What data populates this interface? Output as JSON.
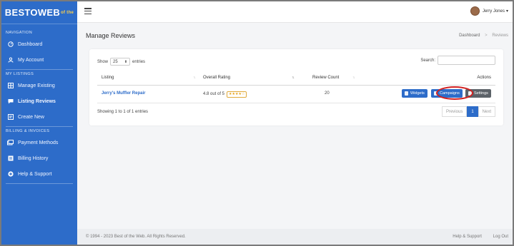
{
  "logo": {
    "main": "BESTOWEB",
    "sup": "of the"
  },
  "user": {
    "name": "Jerry Jones",
    "caret": "▾"
  },
  "sidebar": {
    "sections": [
      "NAVIGATION",
      "MY LISTINGS",
      "BILLING & INVOICES"
    ],
    "items": [
      {
        "label": "Dashboard",
        "icon": "dashboard-icon"
      },
      {
        "label": "My Account",
        "icon": "user-icon"
      },
      {
        "label": "Manage Existing",
        "icon": "grid-icon"
      },
      {
        "label": "Listing Reviews",
        "icon": "chat-icon"
      },
      {
        "label": "Create New",
        "icon": "form-icon"
      },
      {
        "label": "Payment Methods",
        "icon": "cards-icon"
      },
      {
        "label": "Billing History",
        "icon": "ledger-icon"
      },
      {
        "label": "Help & Support",
        "icon": "plus-circle-icon"
      }
    ]
  },
  "page": {
    "title": "Manage Reviews",
    "breadcrumb": [
      "Dashboard",
      "Reviews"
    ],
    "breadcrumb_sep": ">"
  },
  "table": {
    "show_label": "Show",
    "entries_value": "25",
    "entries_label": "entries",
    "search_label": "Search:",
    "headers": [
      "Listing",
      "Overall Rating",
      "Review Count",
      "Actions"
    ],
    "rows": [
      {
        "listing": "Jerry's Muffler Repair",
        "rating": "4.8 out of 5",
        "stars": "★★★★☆",
        "count": "20",
        "actions": [
          "Widgets",
          "Campaigns",
          "Settings"
        ]
      }
    ],
    "info": "Showing 1 to 1 of 1 entries",
    "pager": [
      "Previous",
      "1",
      "Next"
    ]
  },
  "footer": {
    "copyright": "© 1994 - 2023 Best of the Web. All Rights Reserved.",
    "links": [
      "Help & Support",
      "Log Out"
    ]
  },
  "colors": {
    "sidebar": "#2d6cc9",
    "accent": "#2d6cc9",
    "highlight_ring": "#d22020"
  }
}
